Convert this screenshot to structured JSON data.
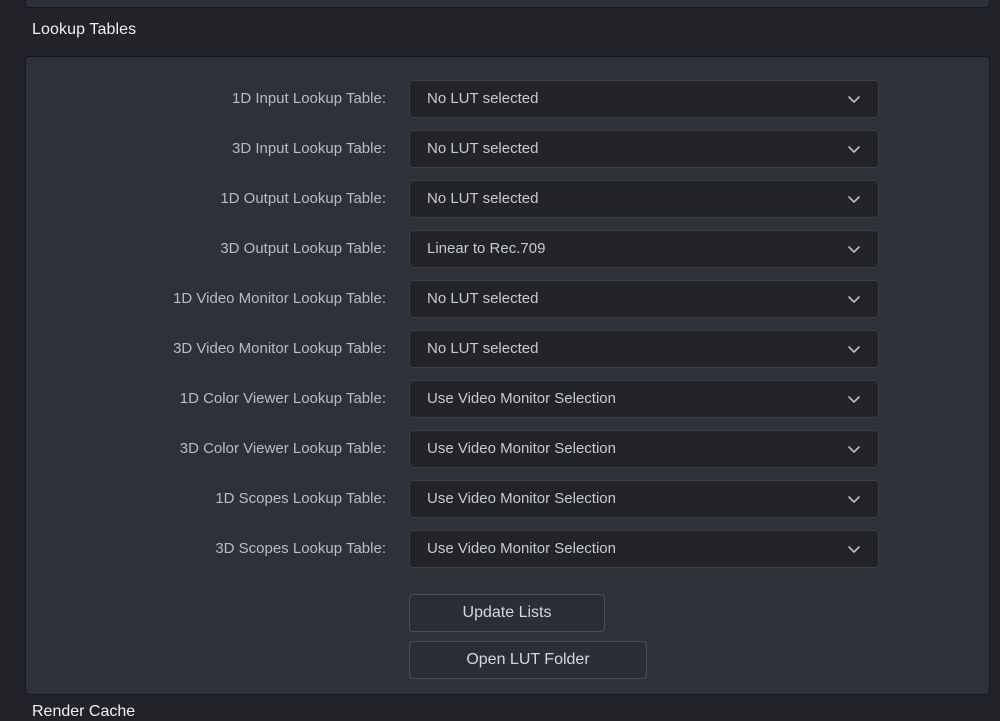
{
  "window": {
    "background_color": "#212329",
    "panel_color": "#2e3138",
    "field_color": "#232427",
    "accent_text_color": "#c6cad1"
  },
  "section": {
    "title": "Lookup Tables"
  },
  "next_section": {
    "title": "Render Cache"
  },
  "rows": [
    {
      "label": "1D Input Lookup Table:",
      "value": "No LUT selected",
      "icon": "chevron-down-icon"
    },
    {
      "label": "3D Input Lookup Table:",
      "value": "No LUT selected",
      "icon": "chevron-down-icon"
    },
    {
      "label": "1D Output Lookup Table:",
      "value": "No LUT selected",
      "icon": "chevron-down-icon"
    },
    {
      "label": "3D Output Lookup Table:",
      "value": "Linear to Rec.709",
      "icon": "chevron-down-icon"
    },
    {
      "label": "1D Video Monitor Lookup Table:",
      "value": "No LUT selected",
      "icon": "chevron-down-icon"
    },
    {
      "label": "3D Video Monitor Lookup Table:",
      "value": "No LUT selected",
      "icon": "chevron-down-icon"
    },
    {
      "label": "1D Color Viewer Lookup Table:",
      "value": "Use Video Monitor Selection",
      "icon": "chevron-down-icon"
    },
    {
      "label": "3D Color Viewer Lookup Table:",
      "value": "Use Video Monitor Selection",
      "icon": "chevron-down-icon"
    },
    {
      "label": "1D Scopes Lookup Table:",
      "value": "Use Video Monitor Selection",
      "icon": "chevron-down-icon"
    },
    {
      "label": "3D Scopes Lookup Table:",
      "value": "Use Video Monitor Selection",
      "icon": "chevron-down-icon"
    }
  ],
  "buttons": {
    "update_lists": "Update Lists",
    "open_lut_folder": "Open LUT Folder"
  }
}
